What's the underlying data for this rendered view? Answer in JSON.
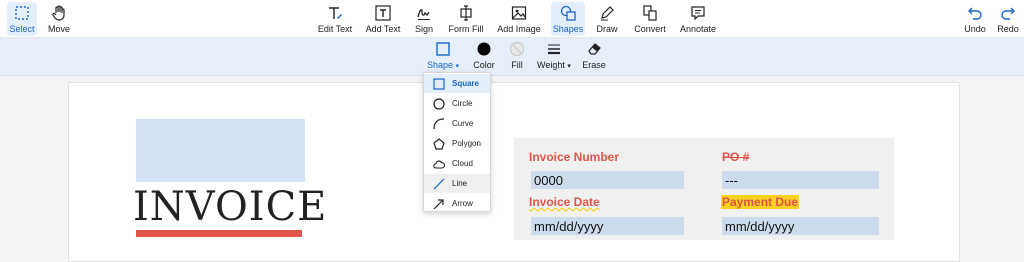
{
  "toolbar": {
    "left": [
      {
        "label": "Select",
        "icon": "select-icon",
        "active": true
      },
      {
        "label": "Move",
        "icon": "hand-icon"
      }
    ],
    "center": [
      {
        "label": "Edit Text",
        "icon": "edit-text-icon"
      },
      {
        "label": "Add Text",
        "icon": "add-text-icon"
      },
      {
        "label": "Sign",
        "icon": "sign-icon"
      },
      {
        "label": "Form Fill",
        "icon": "form-fill-icon"
      },
      {
        "label": "Add Image",
        "icon": "image-icon"
      },
      {
        "label": "Shapes",
        "icon": "shapes-icon",
        "active": true
      },
      {
        "label": "Draw",
        "icon": "pen-icon"
      },
      {
        "label": "Convert",
        "icon": "convert-icon"
      },
      {
        "label": "Annotate",
        "icon": "comment-icon"
      }
    ],
    "right": [
      {
        "label": "Undo",
        "icon": "undo-icon"
      },
      {
        "label": "Redo",
        "icon": "redo-icon"
      }
    ]
  },
  "subtoolbar": {
    "shape": "Shape",
    "color": "Color",
    "fill": "Fill",
    "weight": "Weight",
    "erase": "Erase"
  },
  "shape_menu": {
    "items": [
      {
        "label": "Square",
        "icon": "square-icon",
        "selected": true
      },
      {
        "label": "Circle",
        "icon": "circle-icon"
      },
      {
        "label": "Curve",
        "icon": "curve-icon"
      },
      {
        "label": "Polygon",
        "icon": "polygon-icon"
      },
      {
        "label": "Cloud",
        "icon": "cloud-icon"
      },
      {
        "label": "Line",
        "icon": "line-icon",
        "hovered": true
      },
      {
        "label": "Arrow",
        "icon": "arrow-icon"
      }
    ]
  },
  "document": {
    "title": "INVOICE",
    "invoice_number_label": "Invoice Number",
    "invoice_number_value": "0000",
    "po_label": "PO #",
    "po_value": "---",
    "invoice_date_label": "Invoice Date",
    "invoice_date_value": "mm/dd/yyyy",
    "payment_due_label": "Payment Due",
    "payment_due_value": "mm/dd/yyyy"
  },
  "colors": {
    "accent": "#1a66c8",
    "active_bg": "#e3eefb",
    "subbar_bg": "#e6eefa",
    "brand_red": "#e0554a",
    "field_bg": "#cddcec",
    "highlight": "#f7d320"
  }
}
